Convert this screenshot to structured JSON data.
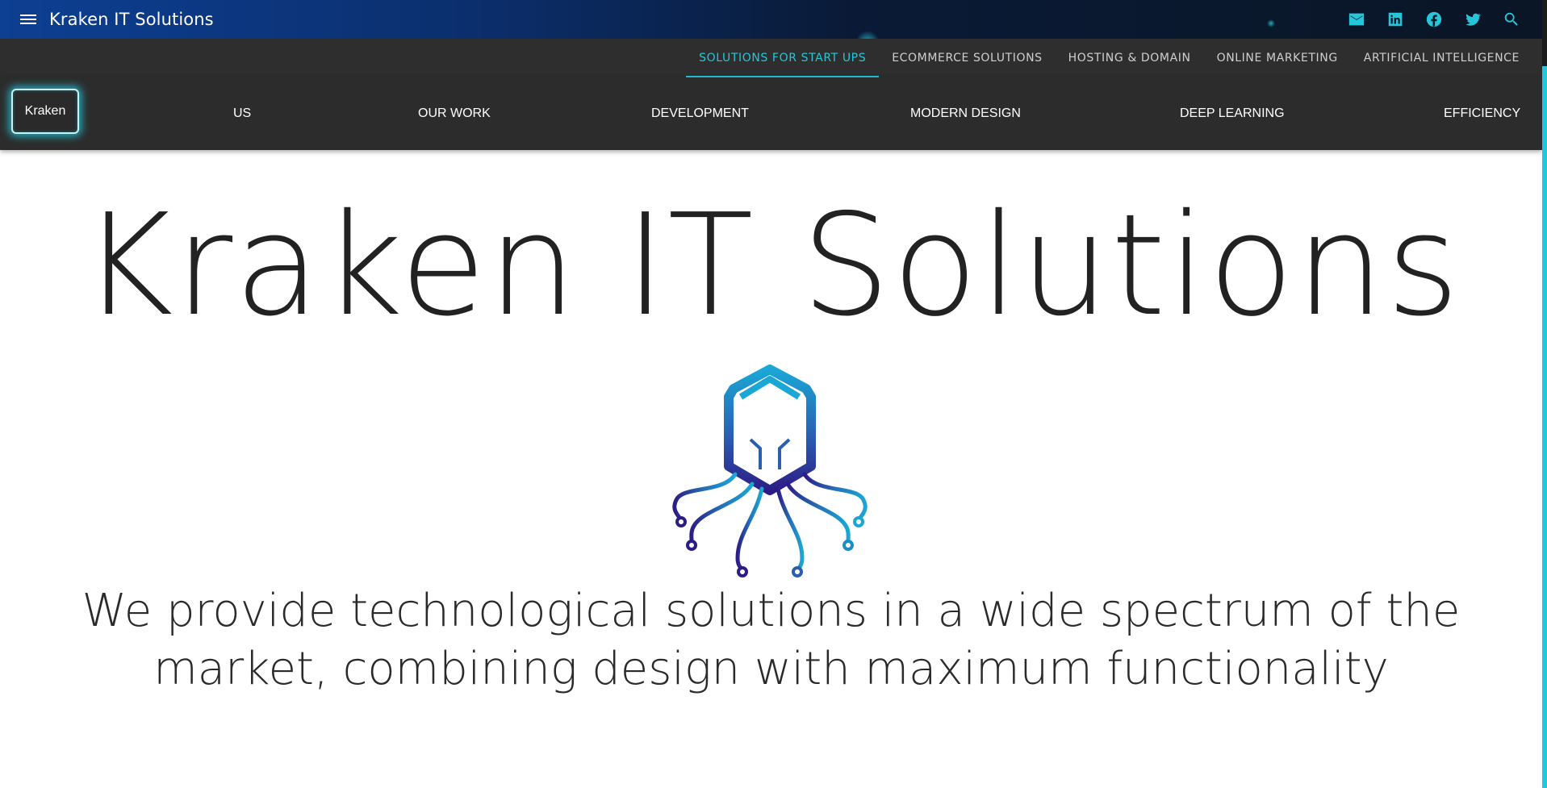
{
  "appbar": {
    "title": "Kraken IT Solutions",
    "icons": [
      "menu-icon",
      "mail-icon",
      "linkedin-icon",
      "facebook-icon",
      "twitter-icon",
      "search-icon"
    ]
  },
  "tabs": [
    {
      "label": "SOLUTIONS FOR START UPS",
      "active": true
    },
    {
      "label": "ECOMMERCE SOLUTIONS",
      "active": false
    },
    {
      "label": "HOSTING & DOMAIN",
      "active": false
    },
    {
      "label": "ONLINE MARKETING",
      "active": false
    },
    {
      "label": "ARTIFICIAL INTELLIGENCE",
      "active": false
    }
  ],
  "nav": {
    "brand": "Kraken",
    "items": [
      "US",
      "OUR WORK",
      "DEVELOPMENT",
      "MODERN DESIGN",
      "DEEP LEARNING",
      "EFFICIENCY"
    ]
  },
  "hero": {
    "title": "Kraken IT Solutions",
    "tagline": "We provide technological solutions in a wide spectrum of the market, combining design with maximum functionality"
  },
  "colors": {
    "accent": "#26c6da",
    "appbar_start": "#0d3f92",
    "appbar_end": "#0a1626",
    "nav_bg": "#2c2c2c",
    "logo_gradient_top": "#1aa7d6",
    "logo_gradient_bottom": "#2c1d86"
  }
}
